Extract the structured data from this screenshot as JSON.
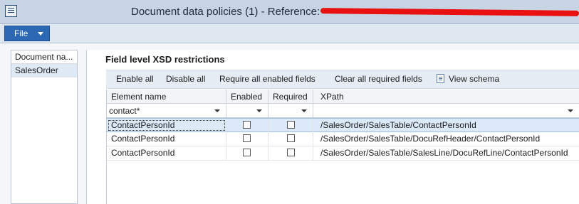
{
  "window": {
    "title": "Document data policies (1) - Reference:"
  },
  "ribbon": {
    "file_label": "File"
  },
  "left_list": {
    "header": "Document na...",
    "items": [
      "SalesOrder"
    ]
  },
  "panel": {
    "title": "Field level XSD restrictions",
    "toolbar": {
      "enable_all": "Enable all",
      "disable_all": "Disable all",
      "require_all": "Require all enabled fields",
      "clear_required": "Clear all required fields",
      "view_schema": "View schema"
    }
  },
  "grid": {
    "columns": {
      "element": "Element name",
      "enabled": "Enabled",
      "required": "Required",
      "xpath": "XPath"
    },
    "filter": {
      "element": "contact*",
      "enabled": "",
      "required": "",
      "xpath": ""
    },
    "rows": [
      {
        "element": "ContactPersonId",
        "enabled": false,
        "required": false,
        "xpath": "/SalesOrder/SalesTable/ContactPersonId"
      },
      {
        "element": "ContactPersonId",
        "enabled": false,
        "required": false,
        "xpath": "/SalesOrder/SalesTable/DocuRefHeader/ContactPersonId"
      },
      {
        "element": "ContactPersonId",
        "enabled": false,
        "required": false,
        "xpath": "/SalesOrder/SalesTable/SalesLine/DocuRefLine/ContactPersonId"
      }
    ]
  },
  "colors": {
    "file_button": "#2d68b5",
    "selected_row": "#dbe9f8",
    "redaction": "#e81010"
  },
  "icons": [
    "app-icon",
    "view-schema-icon",
    "dropdown-arrow-icon"
  ]
}
